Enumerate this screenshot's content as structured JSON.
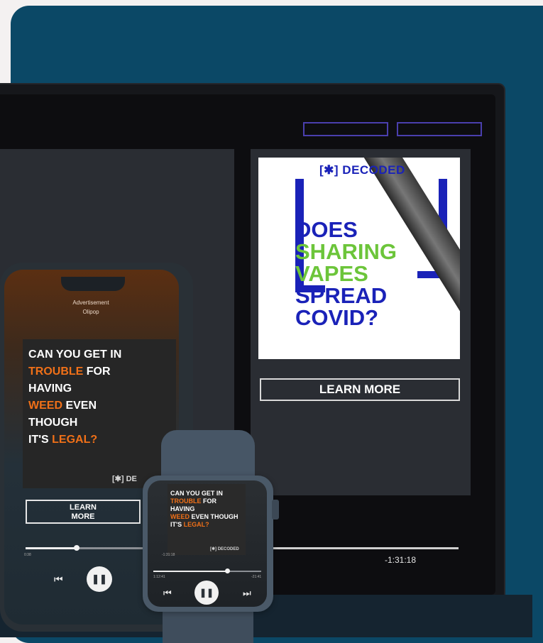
{
  "laptop": {
    "ad_image": {
      "logo_text": "[✱] DECODED",
      "headline_lines": [
        {
          "text": "DOES",
          "color": "#1a22b8"
        },
        {
          "text": "SHARING",
          "color": "#6cc53a"
        },
        {
          "text": "VAPES",
          "color": "#6cc53a"
        },
        {
          "text": "SPREAD",
          "color": "#1a22b8"
        },
        {
          "text": "COVID?",
          "color": "#1a22b8"
        }
      ]
    },
    "learn_more": "LEARN MORE",
    "time_remaining": "-1:31:18"
  },
  "phone": {
    "ad_label": "Advertisement",
    "ad_brand": "Olipop",
    "headline": {
      "l1": "CAN YOU GET IN",
      "l2a": "TROUBLE",
      "l2b": " FOR",
      "l3": "HAVING",
      "l4a": "WEED",
      "l4b": " EVEN",
      "l5": "THOUGH",
      "l6a": "IT'S ",
      "l6b": "LEGAL?"
    },
    "logo": "[✱] DE",
    "learn_more_l1": "LEARN",
    "learn_more_l2": "MORE",
    "time_elapsed": "0:38",
    "controls": {
      "prev": "⏮",
      "pause": "❚❚"
    }
  },
  "watch": {
    "headline": {
      "l1": "CAN YOU GET IN",
      "l2a": "TROUBLE",
      "l2b": " FOR",
      "l3": "HAVING",
      "l4a": "WEED",
      "l4b": " EVEN THOUGH",
      "l5a": "IT'S ",
      "l5b": "LEGAL?"
    },
    "time_left": "-1:31:18",
    "logo": "[✱] DECODED",
    "time_elapsed": "1:12:41",
    "time_remaining": "-21:41",
    "controls": {
      "prev": "⏮",
      "pause": "❚❚",
      "next": "⏭"
    }
  },
  "colors": {
    "background": "#0b4866",
    "accent_orange": "#f07018",
    "accent_blue": "#1a22b8",
    "accent_green": "#6cc53a"
  }
}
